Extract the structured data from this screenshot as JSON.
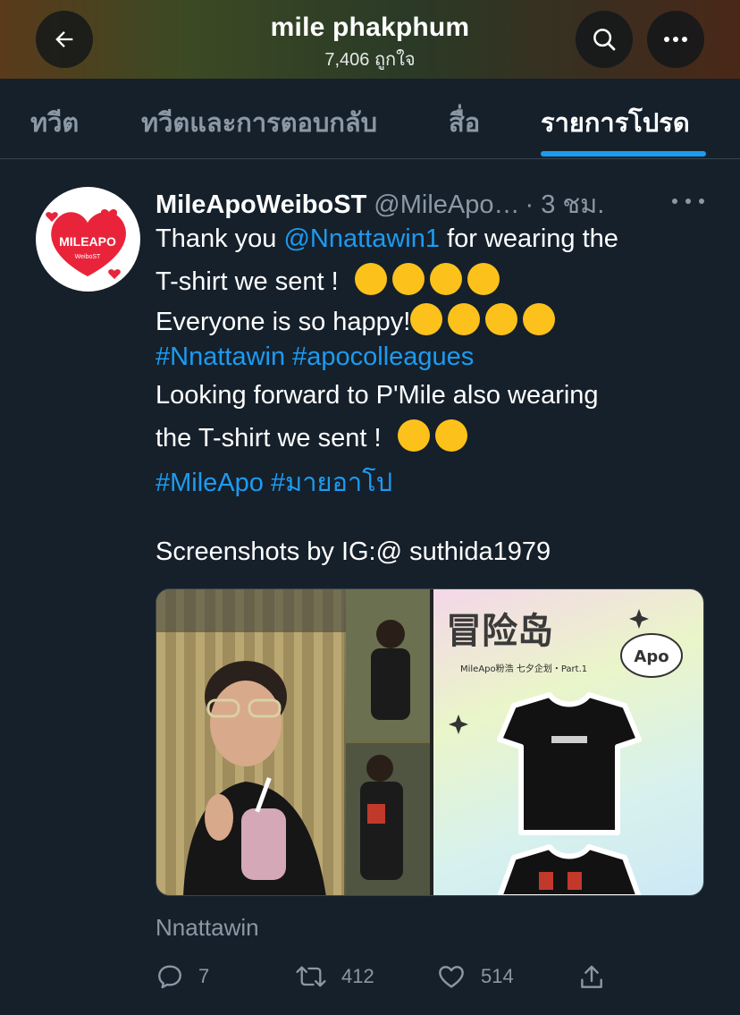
{
  "header": {
    "title": "mile phakphum",
    "subtitle": "7,406 ถูกใจ"
  },
  "tabs": [
    {
      "label": "ทวีต",
      "active": false
    },
    {
      "label": "ทวีตและการตอบกลับ",
      "active": false
    },
    {
      "label": "สื่อ",
      "active": false
    },
    {
      "label": "รายการโปรด",
      "active": true
    }
  ],
  "tweet": {
    "avatar_text": "MILEAPO",
    "avatar_subtext": "WeiboST",
    "display_name": "MileApoWeiboST",
    "handle": "@MileApo…",
    "time": "· 3 ชม.",
    "lines": {
      "l1_pre": "Thank you ",
      "l1_mention": "@Nnattawin1",
      "l1_post": " for wearing the",
      "l2": "T-shirt we sent !",
      "l3": "Everyone is so happy!",
      "l4": "#Nnattawin #apocolleagues",
      "l5": "Looking forward to P'Mile also wearing",
      "l6": "the T-shirt we sent !",
      "l7": "#MileApo #มายอาโป",
      "l8": "Screenshots by IG:@ suthida1979"
    },
    "media": {
      "right_title": "冒险岛",
      "right_sub": "MileApo粉浩 七夕企划・Part.1",
      "right_bubble": "Apo"
    },
    "tagged_user": "Nnattawin",
    "stats": {
      "replies": "7",
      "retweets": "412",
      "likes": "514"
    }
  },
  "icons": {
    "back": "arrow-left-icon",
    "search": "search-icon",
    "more": "more-icon",
    "reply": "reply-icon",
    "retweet": "retweet-icon",
    "like": "heart-icon",
    "share": "share-icon"
  },
  "colors": {
    "background": "#15202b",
    "accent": "#1d9bf0",
    "muted": "#8b98a5"
  }
}
